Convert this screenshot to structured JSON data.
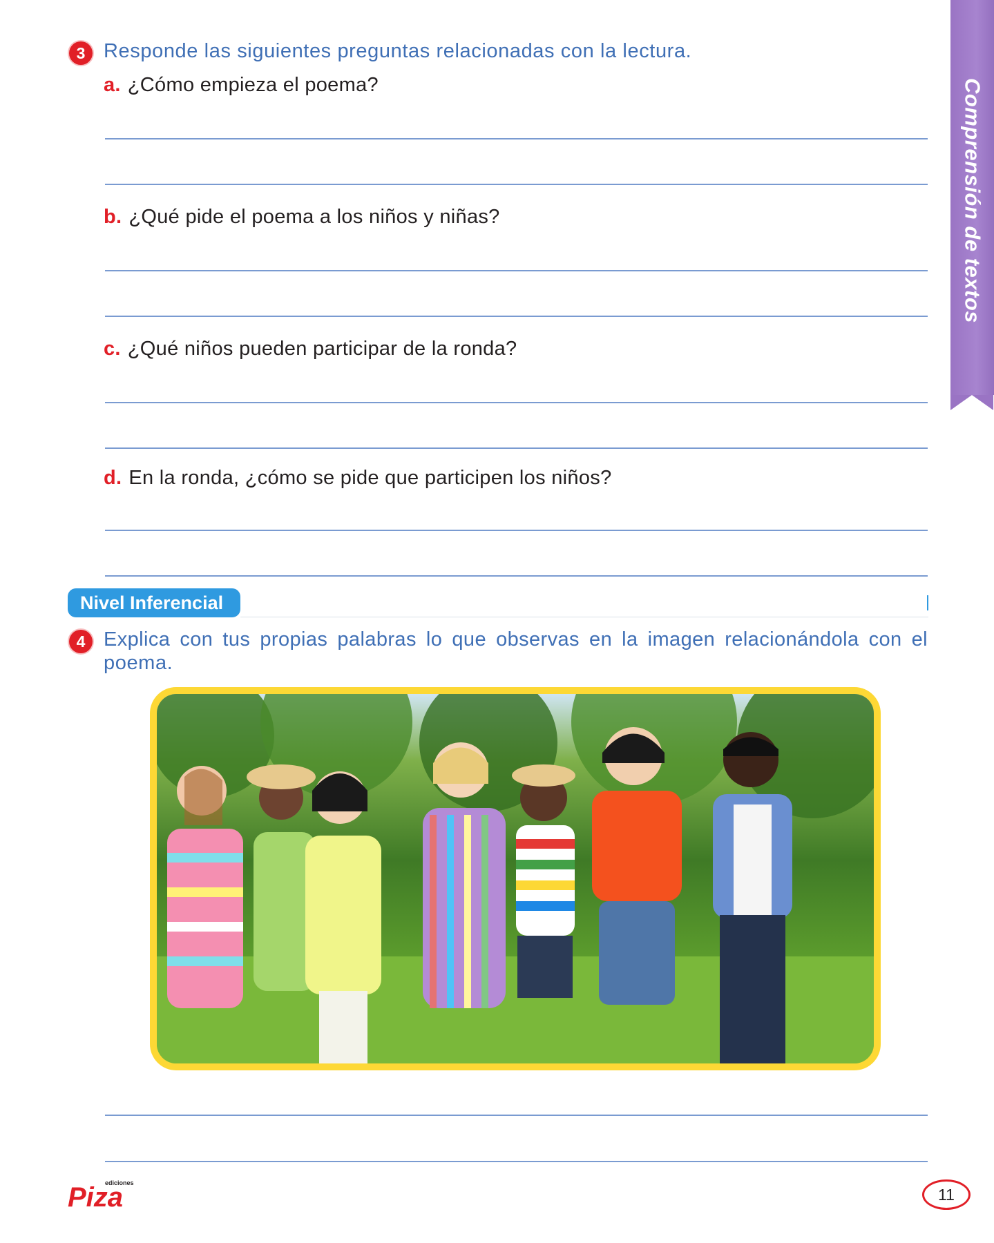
{
  "side_tab": {
    "label": "Comprensión de textos",
    "color": "#9a74c4"
  },
  "activity3": {
    "number": "3",
    "instruction": "Responde las siguientes preguntas relacionadas con la lectura.",
    "questions": [
      {
        "letter": "a.",
        "text": "¿Cómo empieza el poema?"
      },
      {
        "letter": "b.",
        "text": "¿Qué pide el poema a los niños y niñas?"
      },
      {
        "letter": "c.",
        "text": "¿Qué niños pueden participar de la ronda?"
      },
      {
        "letter": "d.",
        "text": "En la ronda, ¿cómo se pide que participen los niños?"
      }
    ]
  },
  "section": {
    "label": "Nivel Inferencial",
    "color": "#2f9ae0"
  },
  "activity4": {
    "number": "4",
    "instruction_line1": "Explica con tus propias palabras lo que observas en la imagen relacionándola con el",
    "instruction_line2": "poema."
  },
  "photo": {
    "frame_color": "#fdd835"
  },
  "footer": {
    "logo_small": "ediciones",
    "logo_main": "Piza",
    "page_number": "11"
  },
  "colors": {
    "accent_red": "#e11f27",
    "instruction_blue": "#3f6fb5",
    "line_blue": "#7a9bd1"
  }
}
